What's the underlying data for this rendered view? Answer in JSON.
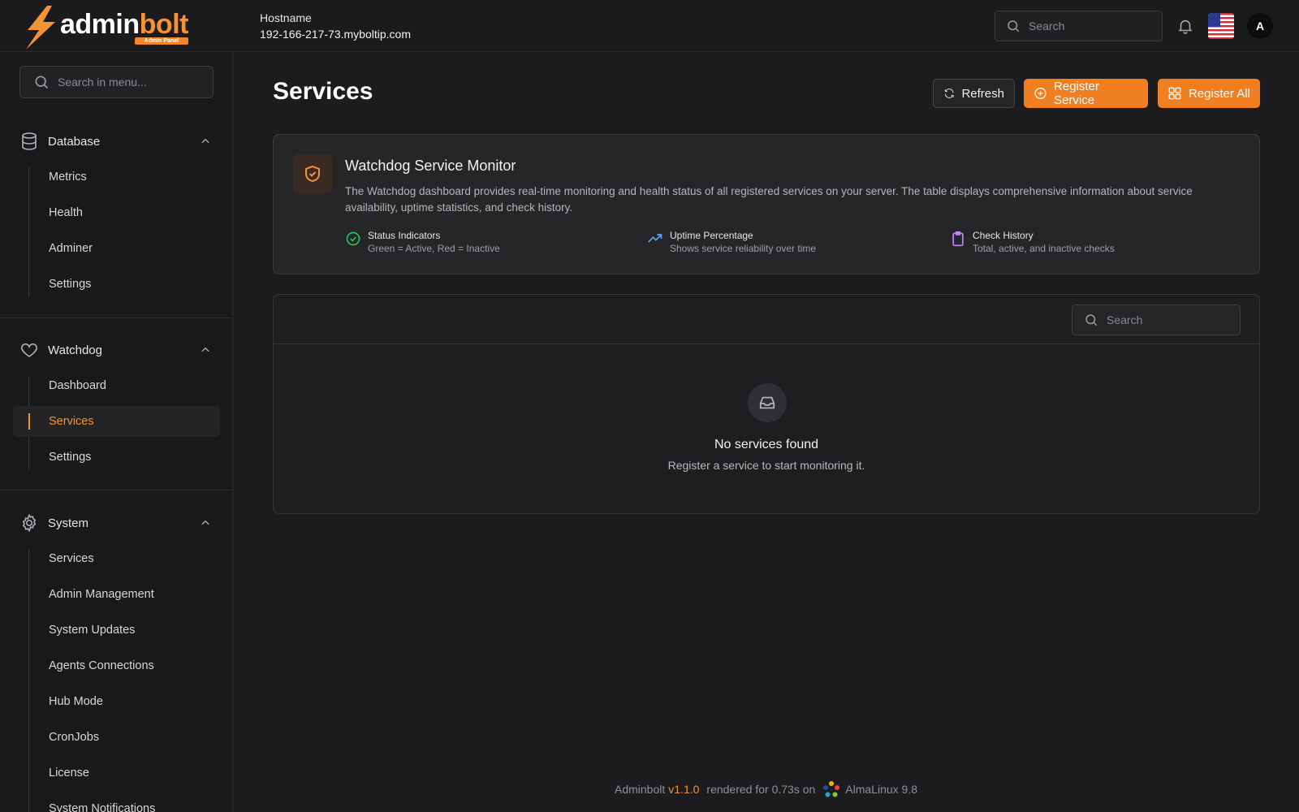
{
  "brand": {
    "name_part1": "admin",
    "name_part2": "bolt",
    "badge": "Admin Panel",
    "accent_color": "#f59233"
  },
  "header": {
    "hostname_label": "Hostname",
    "hostname_value": "192-166-217-73.myboltip.com",
    "search_placeholder": "Search",
    "bell_icon": "bell-icon",
    "flag_icon": "us-flag-icon",
    "avatar_initial": "A"
  },
  "sidebar": {
    "search_placeholder": "Search in menu...",
    "sections": [
      {
        "label": "Database",
        "icon": "database-icon",
        "expanded": true,
        "items": [
          "Metrics",
          "Health",
          "Adminer",
          "Settings"
        ]
      },
      {
        "label": "Watchdog",
        "icon": "heart-icon",
        "expanded": true,
        "items": [
          "Dashboard",
          "Services",
          "Settings"
        ],
        "active_item": "Services"
      },
      {
        "label": "System",
        "icon": "gear-icon",
        "expanded": true,
        "items": [
          "Services",
          "Admin Management",
          "System Updates",
          "Agents Connections",
          "Hub Mode",
          "CronJobs",
          "License",
          "System Notifications"
        ]
      }
    ]
  },
  "main": {
    "title": "Services",
    "buttons": {
      "refresh": "Refresh",
      "register_service": "Register Service",
      "register_all": "Register All"
    },
    "info": {
      "title": "Watchdog Service Monitor",
      "description": "The Watchdog dashboard provides real-time monitoring and health status of all registered services on your server. The table displays comprehensive information about service availability, uptime statistics, and check history.",
      "features": [
        {
          "title": "Status Indicators",
          "desc": "Green = Active, Red = Inactive",
          "icon": "check-circle-icon",
          "color": "#22c55e"
        },
        {
          "title": "Uptime Percentage",
          "desc": "Shows service reliability over time",
          "icon": "trending-up-icon",
          "color": "#60a5fa"
        },
        {
          "title": "Check History",
          "desc": "Total, active, and inactive checks",
          "icon": "clipboard-icon",
          "color": "#c084fc"
        }
      ]
    },
    "table": {
      "search_placeholder": "Search",
      "empty_title": "No services found",
      "empty_subtitle": "Register a service to start monitoring it."
    }
  },
  "footer": {
    "product": "Adminbolt",
    "version": "v1.1.0",
    "render_text": "rendered for 0.73s on",
    "os": "AlmaLinux 9.8"
  }
}
